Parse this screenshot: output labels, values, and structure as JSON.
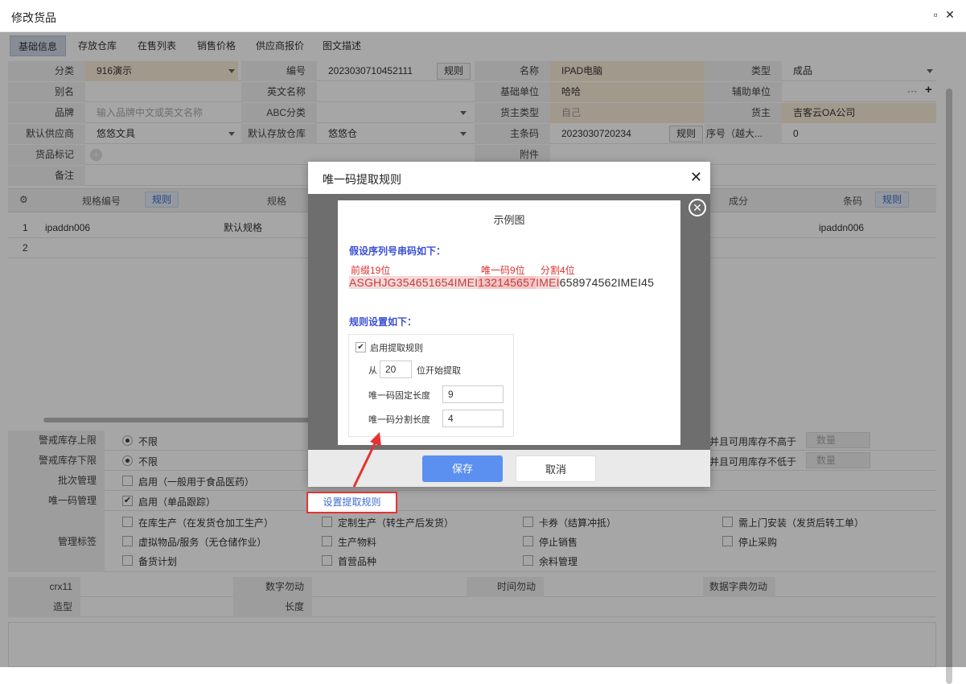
{
  "window": {
    "title": "修改货品",
    "maximize_icon": "▫",
    "close_icon": "✕"
  },
  "tabs": [
    "基础信息",
    "存放仓库",
    "在售列表",
    "销售价格",
    "供应商报价",
    "图文描述"
  ],
  "form": {
    "category_label": "分类",
    "category_value": "916演示",
    "code_label": "编号",
    "code_value": "2023030710452111",
    "code_rule": "规则",
    "name_label": "名称",
    "name_value": "IPAD电脑",
    "type_label": "类型",
    "type_value": "成品",
    "alias_label": "别名",
    "english_label": "英文名称",
    "base_unit_label": "基础单位",
    "base_unit_value": "哈哈",
    "aux_unit_label": "辅助单位",
    "brand_label": "品牌",
    "brand_placeholder": "输入品牌中文或英文名称",
    "abc_label": "ABC分类",
    "owner_type_label": "货主类型",
    "owner_type_value": "自己",
    "owner_label": "货主",
    "owner_value": "吉客云OA公司",
    "supplier_label": "默认供应商",
    "supplier_value": "悠悠文具",
    "warehouse_label": "默认存放仓库",
    "warehouse_value": "悠悠仓",
    "barcode_label": "主条码",
    "barcode_value": "2023030720234",
    "barcode_rule": "规则",
    "seq_label": "序号（越大...",
    "seq_value": "0",
    "mark_label": "货品标记",
    "attach_label": "附件",
    "remark_label": "备注"
  },
  "grid": {
    "headers": {
      "spec_code": "规格编号",
      "spec": "规格",
      "ingredient": "成分",
      "barcode": "条码",
      "rule": "规则"
    },
    "rows": [
      {
        "no": "1",
        "spec_code": "ipaddn006",
        "spec": "默认规格",
        "barcode": "ipaddn006"
      },
      {
        "no": "2",
        "spec_code": "",
        "spec": "",
        "barcode": ""
      }
    ]
  },
  "settings": {
    "upper_label": "警戒库存上限",
    "upper_value": "不限",
    "lower_label": "警戒库存下限",
    "lower_value": "不限",
    "upper_right": "并且可用库存不高于",
    "lower_right": "并且可用库存不低于",
    "qty_placeholder": "数量",
    "batch_label": "批次管理",
    "batch_value": "启用（一般用于食品医药）",
    "unique_label": "唯一码管理",
    "unique_value": "启用（单品跟踪）",
    "set_rule": "设置提取规则",
    "tags_label": "管理标签",
    "tags": [
      "在库生产（在发货仓加工生产）",
      "定制生产（转生产后发货）",
      "卡券（结算冲抵）",
      "需上门安装（发货后转工单）",
      "虚拟物品/服务（无仓储作业）",
      "生产物料",
      "停止销售",
      "停止采购",
      "备货计划",
      "首营品种",
      "余料管理"
    ]
  },
  "custom": {
    "crx11": "crx11",
    "number": "数字勿动",
    "time": "时间勿动",
    "dict": "数据字典勿动",
    "shape": "造型",
    "length": "长度"
  },
  "dialog": {
    "title": "唯一码提取规则",
    "close": "✕",
    "save": "保存",
    "cancel": "取消",
    "example_title": "示例图",
    "assume": "假设序列号串码如下：",
    "prefix_note": "前缀19位",
    "unique_note": "唯一码9位",
    "split_note": "分割4位",
    "serial_p1": "ASGHJG354651654IMEI",
    "serial_p2": "132145657",
    "serial_p3": "IMEI",
    "serial_rest": "658974562IMEI45",
    "rules_title": "规则设置如下：",
    "enable": "启用提取规则",
    "from": "从",
    "from_value": "20",
    "from_suffix": "位开始提取",
    "fixed_len_label": "唯一码固定长度",
    "fixed_len_value": "9",
    "split_len_label": "唯一码分割长度",
    "split_len_value": "4"
  }
}
